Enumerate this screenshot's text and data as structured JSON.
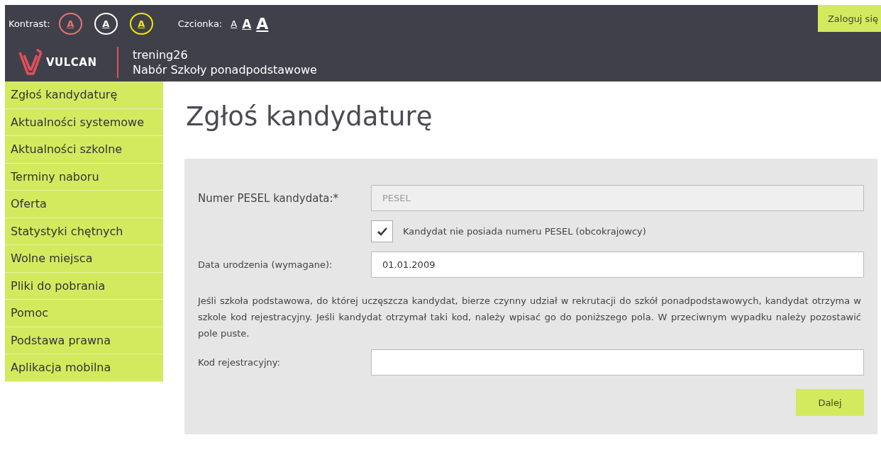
{
  "toolbar": {
    "contrast_label": "Kontrast:",
    "contrast_options": [
      {
        "label": "A",
        "color": "#e57373"
      },
      {
        "label": "A",
        "color": "#ffffff"
      },
      {
        "label": "A",
        "color": "#f0e800"
      }
    ],
    "font_label": "Czcionka:",
    "font_options": [
      "A",
      "A",
      "A"
    ],
    "login_button": "Zaloguj się"
  },
  "header": {
    "logo_text": "VULCAN",
    "instance": "trening26",
    "subtitle": "Nabór Szkoły ponadpodstawowe"
  },
  "sidebar": {
    "items": [
      {
        "label": "Zgłoś kandydaturę"
      },
      {
        "label": "Aktualności systemowe"
      },
      {
        "label": "Aktualności szkolne"
      },
      {
        "label": "Terminy naboru"
      },
      {
        "label": "Oferta"
      },
      {
        "label": "Statystyki chętnych"
      },
      {
        "label": "Wolne miejsca"
      },
      {
        "label": "Pliki do pobrania"
      },
      {
        "label": "Pomoc"
      },
      {
        "label": "Podstawa prawna"
      },
      {
        "label": "Aplikacja mobilna"
      }
    ]
  },
  "page_title": "Zgłoś kandydaturę",
  "form": {
    "pesel": {
      "label": "Numer PESEL kandydata:*",
      "placeholder": "PESEL",
      "disabled": true
    },
    "no_pesel": {
      "label": "Kandydat nie posiada numeru PESEL (obcokrajowcy)",
      "checked": true
    },
    "birth_date": {
      "label": "Data urodzenia (wymagane):",
      "value": "01.01.2009"
    },
    "info": "Jeśli szkoła podstawowa, do której uczęszcza kandydat, bierze czynny udział w rekrutacji do szkół ponadpodstawowych, kandydat otrzyma w szkole kod rejestracyjny. Jeśli kandydat otrzymał taki kod, należy wpisać go do poniższego pola. W przeciwnym wypadku należy pozostawić pole puste.",
    "code": {
      "label": "Kod rejestracyjny:"
    },
    "next_button": "Dalej"
  }
}
